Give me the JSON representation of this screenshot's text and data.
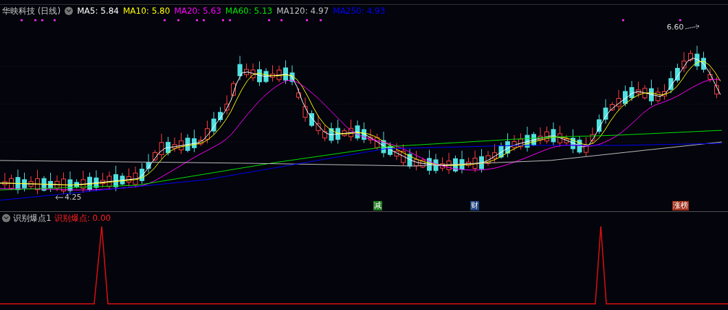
{
  "header": {
    "title": "华映科技 (日线)",
    "indicators": [
      {
        "label": "MA5: 5.84",
        "color": "#ffffff"
      },
      {
        "label": "MA10: 5.80",
        "color": "#ffff00"
      },
      {
        "label": "MA20: 5.63",
        "color": "#ff00ff"
      },
      {
        "label": "MA60: 5.13",
        "color": "#00e600"
      },
      {
        "label": "MA120: 4.97",
        "color": "#c0c0c0"
      },
      {
        "label": "MA250: 4.93",
        "color": "#0000ff"
      }
    ]
  },
  "price_marks": [
    {
      "label": "6.60",
      "kind": "high"
    },
    {
      "label": "4.25",
      "kind": "low"
    }
  ],
  "event_tags": [
    {
      "label": "减",
      "color": "#1e7a1e"
    },
    {
      "label": "财",
      "color": "#1c3f7a"
    },
    {
      "label": "涨榜",
      "color": "#a0301c"
    }
  ],
  "sub_panel": {
    "title": "识别爆点1",
    "reading": "识别爆点: 0.00"
  }
}
